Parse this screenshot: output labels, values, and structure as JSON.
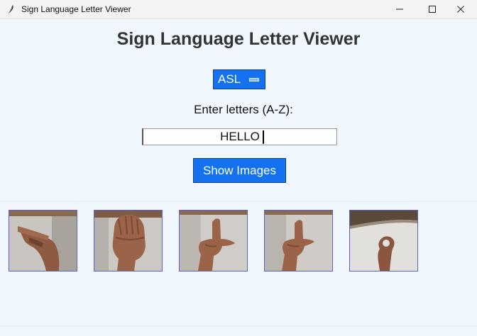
{
  "window": {
    "title": "Sign Language Letter Viewer"
  },
  "app": {
    "heading": "Sign Language Letter Viewer",
    "language_select": {
      "selected": "ASL"
    },
    "prompt": "Enter letters (A-Z):",
    "letters_input": {
      "value": "HELLO"
    },
    "show_button_label": "Show Images"
  },
  "images": [
    {
      "icon": "hand-sign-H-icon"
    },
    {
      "icon": "hand-sign-E-icon"
    },
    {
      "icon": "hand-sign-L-icon"
    },
    {
      "icon": "hand-sign-L-icon"
    },
    {
      "icon": "hand-sign-O-icon"
    }
  ],
  "colors": {
    "accent": "#1472f0",
    "background": "#f0f7ff",
    "tile_border": "#5a64c8"
  }
}
